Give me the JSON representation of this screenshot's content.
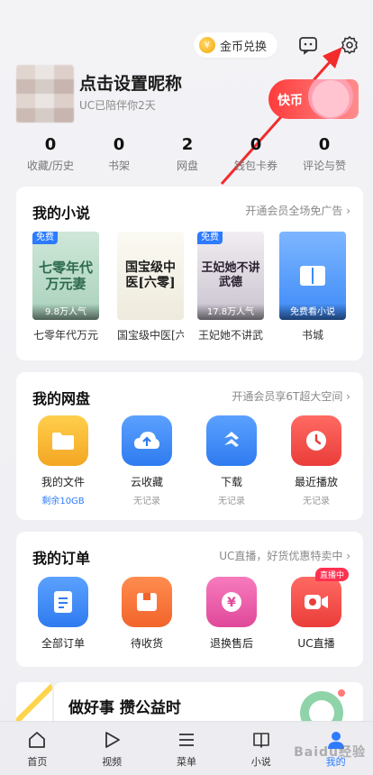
{
  "header": {
    "coin_label": "金币兑换",
    "icons": {
      "coin": "coin-icon",
      "message": "message-icon",
      "settings": "gear-icon"
    }
  },
  "profile": {
    "nickname": "点击设置昵称",
    "days": "UC已陪伴你2天",
    "promo_label": "快币"
  },
  "stats": [
    {
      "value": "0",
      "label": "收藏/历史"
    },
    {
      "value": "0",
      "label": "书架"
    },
    {
      "value": "2",
      "label": "网盘"
    },
    {
      "value": "0",
      "label": "钱包卡券"
    },
    {
      "value": "0",
      "label": "评论与赞"
    }
  ],
  "novels": {
    "title": "我的小说",
    "link": "开通会员全场免广告 ›",
    "items": [
      {
        "cover_text": "七零年代\n万元妻",
        "tag": "免费",
        "popularity": "9.8万人气",
        "name": "七零年代万元"
      },
      {
        "cover_text": "国宝级中医[六零]",
        "tag": "",
        "popularity": "",
        "name": "国宝级中医[六"
      },
      {
        "cover_text": "王妃她不讲武德",
        "tag": "免费",
        "popularity": "17.8万人气",
        "name": "王妃她不讲武"
      },
      {
        "cover_text": "",
        "tag": "",
        "popularity": "免费看小说",
        "name": "书城"
      }
    ]
  },
  "cloud": {
    "title": "我的网盘",
    "link": "开通会员享6T超大空间 ›",
    "items": [
      {
        "label": "我的文件",
        "sub": "剩余10GB",
        "icon": "folder-icon",
        "color": "#f6b52c"
      },
      {
        "label": "云收藏",
        "sub": "无记录",
        "icon": "cloud-upload-icon",
        "color": "#3f8cf5"
      },
      {
        "label": "下载",
        "sub": "无记录",
        "icon": "download-icon",
        "color": "#3f8cf5"
      },
      {
        "label": "最近播放",
        "sub": "无记录",
        "icon": "clock-icon",
        "color": "#f0524d"
      }
    ]
  },
  "orders": {
    "title": "我的订单",
    "link": "UC直播，好货优惠特卖中 ›",
    "items": [
      {
        "label": "全部订单",
        "icon": "order-list-icon",
        "color": "#3f8cf5",
        "badge": ""
      },
      {
        "label": "待收货",
        "icon": "package-icon",
        "color": "#f57a3c",
        "badge": ""
      },
      {
        "label": "退换售后",
        "icon": "yuan-return-icon",
        "color": "#ef5da6",
        "badge": ""
      },
      {
        "label": "UC直播",
        "icon": "live-camera-icon",
        "color": "#f0524d",
        "badge": "直播中"
      }
    ]
  },
  "banner": {
    "title": "做好事 攒公益时"
  },
  "bottom_nav": [
    {
      "label": "首页",
      "icon": "home-icon"
    },
    {
      "label": "视频",
      "icon": "play-icon"
    },
    {
      "label": "菜单",
      "icon": "menu-icon"
    },
    {
      "label": "小说",
      "icon": "book-icon"
    },
    {
      "label": "我的",
      "icon": "profile-icon"
    }
  ],
  "watermark": "Baidu经验",
  "colors": {
    "accent": "#2d7bff",
    "promo": "#ff3b3b",
    "background": "#f1f1f4"
  }
}
